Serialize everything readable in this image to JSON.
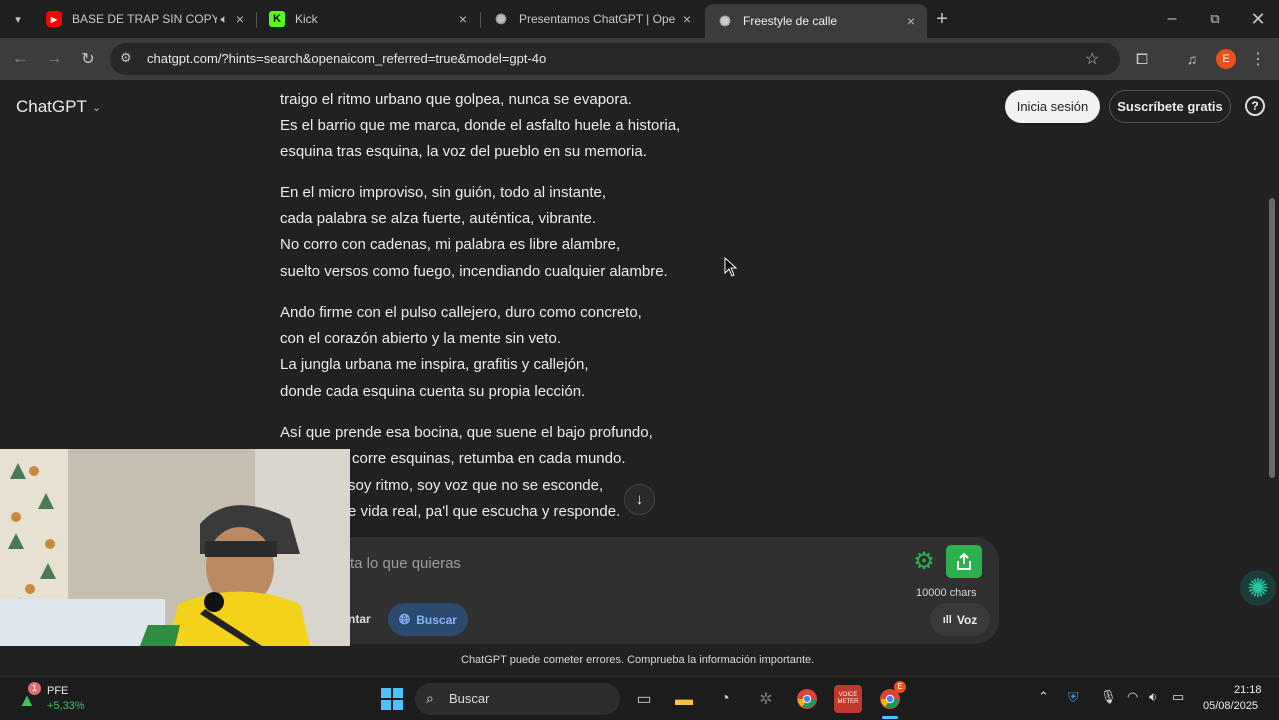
{
  "browser": {
    "tabs": [
      {
        "title": "BASE DE TRAP SIN COPYRIG",
        "icon": "youtube-icon",
        "muted_audio": true
      },
      {
        "title": "Kick",
        "icon": "kick-icon"
      },
      {
        "title": "Presentamos ChatGPT | OpenAI",
        "icon": "openai-icon"
      },
      {
        "title": "Freestyle de calle",
        "icon": "openai-icon",
        "active": true
      }
    ],
    "url": "chatgpt.com/?hints=search&openaicom_referred=true&model=gpt-4o",
    "profile_initial": "E"
  },
  "chatgpt": {
    "model_label": "ChatGPT",
    "login_label": "Inicia sesión",
    "signup_label": "Suscríbete gratis",
    "help_label": "?",
    "poem_lines": [
      "traigo el ritmo urbano que golpea, nunca se evapora.",
      "Es el barrio que me marca, donde el asfalto huele a historia,",
      "esquina tras esquina, la voz del pueblo en su memoria.",
      "En el micro improviso, sin guión, todo al instante,",
      "cada palabra se alza fuerte, auténtica, vibrante.",
      "No corro con cadenas, mi palabra es libre alambre,",
      "suelto versos como fuego, incendiando cualquier alambre.",
      "Ando firme con el pulso callejero, duro como concreto,",
      "con el corazón abierto y la mente sin veto.",
      "La jungla urbana me inspira, grafitis y callejón,",
      "donde cada esquina cuenta su propia lección.",
      "Así que prende esa bocina, que suene el bajo profundo,",
      "corre esquinas, retumba en cada mundo.",
      "soy ritmo, soy voz que no se esconde,",
      "e vida real, pa'l que escucha y responde."
    ],
    "composer": {
      "placeholder": "ta lo que quieras",
      "attach_label": "ntar",
      "search_label": "Buscar",
      "voice_label": "Voz",
      "chars_label": "10000 chars"
    },
    "disclaimer": "ChatGPT puede cometer errores. Comprueba la información importante."
  },
  "taskbar": {
    "stock_name": "PFE",
    "stock_change": "+5,33%",
    "stock_badge": "1",
    "search_label": "Buscar",
    "time": "21:18",
    "date": "05/08/2025",
    "chrome_badge": "E",
    "voice_app_label": "VOICE METER"
  },
  "colors": {
    "page_bg": "#212121",
    "accent_blue": "#8ab4f8",
    "green_button": "#2bb24c",
    "profile_orange": "#e8511a"
  }
}
